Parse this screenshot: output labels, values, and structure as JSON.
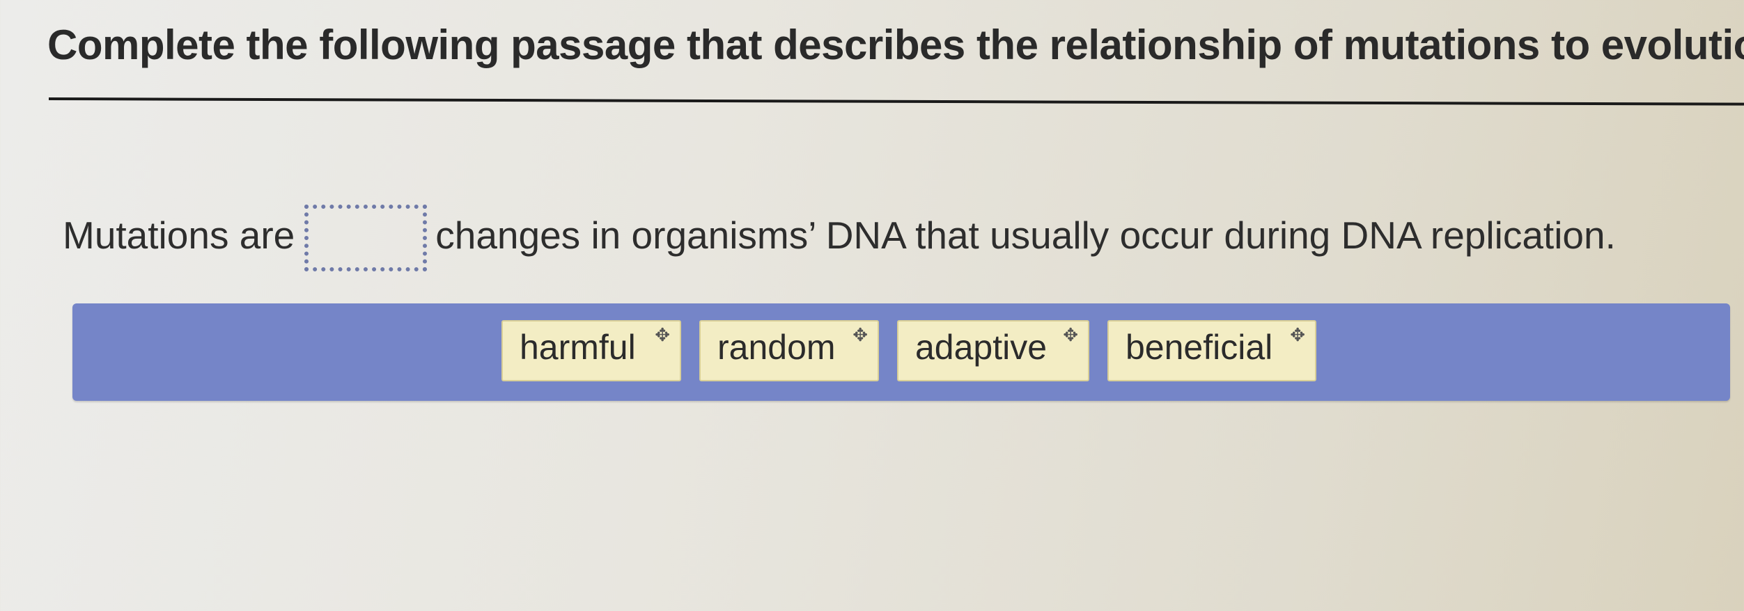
{
  "question": {
    "title": "Complete the following passage that describes the relationship of mutations to evolution."
  },
  "passage": {
    "before_blank": "Mutations are",
    "after_blank": "changes in organisms’ DNA that usually occur during DNA replication.",
    "blank_value": ""
  },
  "word_bank": {
    "tiles": [
      {
        "label": "harmful"
      },
      {
        "label": "random"
      },
      {
        "label": "adaptive"
      },
      {
        "label": "beneficial"
      }
    ],
    "move_icon_glyph": "✥"
  },
  "colors": {
    "word_bank_bg": "#7585c8",
    "tile_bg": "#f3edc4",
    "drop_zone_border": "#6f7aa8"
  }
}
